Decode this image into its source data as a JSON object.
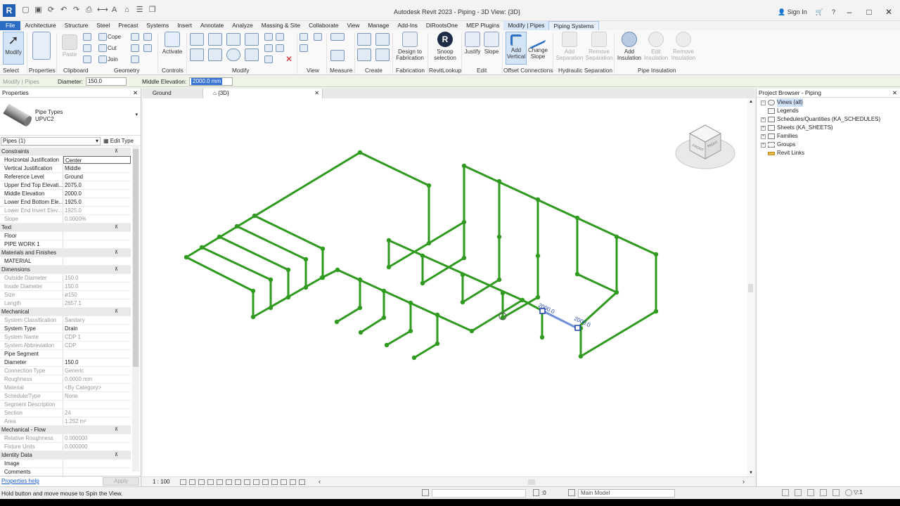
{
  "app": {
    "title": "Autodesk Revit 2023 - Piping - 3D View: {3D}",
    "logo": "R",
    "sign_in": "Sign In"
  },
  "tabs": [
    "File",
    "Architecture",
    "Structure",
    "Steel",
    "Precast",
    "Systems",
    "Insert",
    "Annotate",
    "Analyze",
    "Massing & Site",
    "Collaborate",
    "View",
    "Manage",
    "Add-Ins",
    "DiRootsOne",
    "MEP Plugins",
    "Modify | Pipes",
    "Piping Systems"
  ],
  "ribbon": {
    "modify": "Modify",
    "paste": "Paste",
    "properties": "Properties",
    "cope": "Cope",
    "cut": "Cut",
    "join": "Join",
    "activate": "Activate",
    "design_to_fabrication": "Design to Fabrication",
    "snoop_selection": "Snoop selection",
    "justify": "Justify",
    "slope": "Slope",
    "add_vertical": "Add Vertical",
    "change_slope": "Change Slope",
    "add_separation": "Add Separation",
    "remove_separation": "Remove Separation",
    "add_insulation": "Add Insulation",
    "edit_insulation": "Edit Insulation",
    "remove_insulation": "Remove Insulation",
    "panels": [
      "Select",
      "Properties",
      "Clipboard",
      "Geometry",
      "Controls",
      "Modify",
      "View",
      "Measure",
      "Create",
      "Fabrication",
      "RevitLookup",
      "Edit",
      "Offset Connections",
      "Hydraulic Separation",
      "Pipe Insulation"
    ]
  },
  "options_bar": {
    "context": "Modify | Pipes",
    "diameter_label": "Diameter:",
    "diameter_value": "150.0",
    "middle_elevation_label": "Middle Elevation:",
    "middle_elevation_value": "2000.0 mm"
  },
  "properties": {
    "header": "Properties",
    "type_family": "Pipe Types",
    "type_name": "UPVC2",
    "instance": "Pipes (1)",
    "edit_type": "Edit Type",
    "help": "Properties help",
    "apply": "Apply",
    "rows": [
      {
        "kind": "group",
        "k": "Constraints"
      },
      {
        "k": "Horizontal Justification",
        "v": "Center",
        "editing": true
      },
      {
        "k": "Vertical Justification",
        "v": "Middle"
      },
      {
        "k": "Reference Level",
        "v": "Ground"
      },
      {
        "k": "Upper End Top Elevati...",
        "v": "2075.0"
      },
      {
        "k": "Middle Elevation",
        "v": "2000.0"
      },
      {
        "k": "Lower End Bottom Ele...",
        "v": "1925.0"
      },
      {
        "k": "Lower End Invert Elev...",
        "v": "1925.0",
        "grey": true
      },
      {
        "k": "Slope",
        "v": "0.0000%",
        "grey": true
      },
      {
        "kind": "group",
        "k": "Text"
      },
      {
        "k": "Floor",
        "v": ""
      },
      {
        "k": "PIPE WORK 1",
        "v": ""
      },
      {
        "kind": "group",
        "k": "Materials and Finishes"
      },
      {
        "k": "MATERIAL",
        "v": ""
      },
      {
        "kind": "group",
        "k": "Dimensions"
      },
      {
        "k": "Outside Diameter",
        "v": "150.0",
        "grey": true
      },
      {
        "k": "Inside Diameter",
        "v": "150.0",
        "grey": true
      },
      {
        "k": "Size",
        "v": "ø150",
        "grey": true
      },
      {
        "k": "Length",
        "v": "2657.1",
        "grey": true
      },
      {
        "kind": "group",
        "k": "Mechanical"
      },
      {
        "k": "System Classification",
        "v": "Sanitary",
        "grey": true
      },
      {
        "k": "System Type",
        "v": "Drain"
      },
      {
        "k": "System Name",
        "v": "CDP 1",
        "grey": true
      },
      {
        "k": "System Abbreviation",
        "v": "CDP",
        "grey": true
      },
      {
        "k": "Pipe Segment",
        "v": ""
      },
      {
        "k": "Diameter",
        "v": "150.0"
      },
      {
        "k": "Connection Type",
        "v": "Generic",
        "grey": true
      },
      {
        "k": "Roughness",
        "v": "0.0000 mm",
        "grey": true
      },
      {
        "k": "Material",
        "v": "<By Category>",
        "grey": true
      },
      {
        "k": "Schedule/Type",
        "v": "None",
        "grey": true
      },
      {
        "k": "Segment Description",
        "v": "",
        "grey": true
      },
      {
        "k": "Section",
        "v": "24",
        "grey": true
      },
      {
        "k": "Area",
        "v": "1.252 m²",
        "grey": true
      },
      {
        "kind": "group",
        "k": "Mechanical - Flow"
      },
      {
        "k": "Relative Roughness",
        "v": "0.000000",
        "grey": true
      },
      {
        "k": "Fixture Units",
        "v": "0.000000",
        "grey": true
      },
      {
        "kind": "group",
        "k": "Identity Data"
      },
      {
        "k": "Image",
        "v": ""
      },
      {
        "k": "Comments",
        "v": ""
      }
    ]
  },
  "view_tabs": [
    {
      "label": "Ground"
    },
    {
      "label": "{3D}"
    }
  ],
  "viewport": {
    "scale": "1 : 100",
    "dim1": "2000.0",
    "dim2": "2000.0",
    "cube_front": "FRONT",
    "cube_right": "RIGHT",
    "pipe_color": "#2f9a1f"
  },
  "browser": {
    "header": "Project Browser - Piping",
    "items": [
      "Views (all)",
      "Legends",
      "Schedules/Quantities (KA_SCHEDULES)",
      "Sheets (KA_SHEETS)",
      "Families",
      "Groups",
      "Revit Links"
    ]
  },
  "status": {
    "hint": "Hold button and move mouse to Spin the View.",
    "zero": ":0",
    "model": "Main Model"
  }
}
